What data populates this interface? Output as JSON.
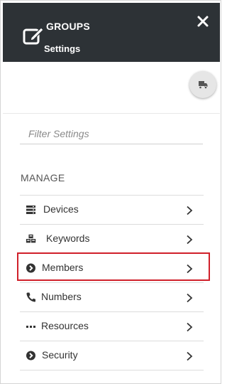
{
  "header": {
    "title": "GROUPS",
    "subtitle": "Settings",
    "logo_icon": "edit-square-icon",
    "close_icon": "close-icon"
  },
  "action_button": {
    "icon": "truck-icon"
  },
  "filter": {
    "placeholder": "Filter Settings",
    "value": ""
  },
  "section": {
    "label": "MANAGE"
  },
  "menu": {
    "items": [
      {
        "label": "Devices",
        "icon": "server-icon"
      },
      {
        "label": "Keywords",
        "icon": "cubes-icon"
      },
      {
        "label": "Members",
        "icon": "circle-arrow-icon",
        "selected": true
      },
      {
        "label": "Numbers",
        "icon": "phone-icon"
      },
      {
        "label": "Resources",
        "icon": "ellipsis-icon"
      },
      {
        "label": "Security",
        "icon": "circle-arrow-icon"
      }
    ]
  },
  "colors": {
    "header_bg": "#2d3236",
    "highlight": "#d0202a"
  }
}
